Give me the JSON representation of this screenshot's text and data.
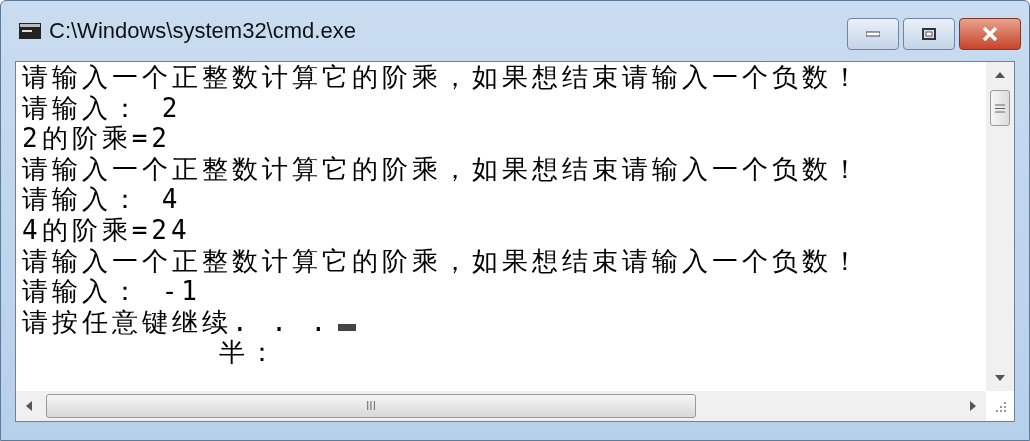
{
  "window": {
    "title": "C:\\Windows\\system32\\cmd.exe"
  },
  "console": {
    "lines": [
      "请输入一个正整数计算它的阶乘，如果想结束请输入一个负数！",
      "请输入： 2",
      "2的阶乘=2",
      "请输入一个正整数计算它的阶乘，如果想结束请输入一个负数！",
      "请输入： 4",
      "4的阶乘=24",
      "请输入一个正整数计算它的阶乘，如果想结束请输入一个负数！",
      "请输入： -1",
      "请按任意键继续. . .",
      "          半："
    ],
    "cursor_visible": true
  },
  "scrollbar_grip": "III"
}
